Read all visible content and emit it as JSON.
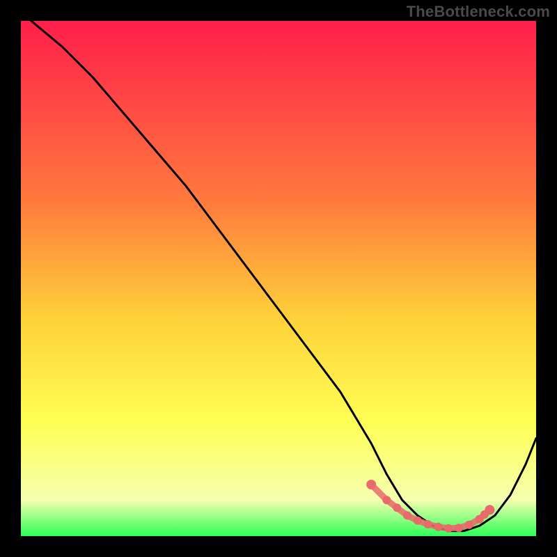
{
  "watermark": "TheBottleneck.com",
  "colors": {
    "black": "#000000",
    "curve": "#000000",
    "marker_fill": "#e96a6a",
    "grad_top": "#ff1f4b",
    "grad_mid1": "#ff7a3d",
    "grad_mid2": "#ffd23a",
    "grad_mid3": "#ffff55",
    "grad_mid4": "#f5ffb0",
    "grad_bot": "#2dff57"
  },
  "chart_data": {
    "type": "line",
    "title": "",
    "xlabel": "",
    "ylabel": "",
    "xlim": [
      0,
      100
    ],
    "ylim": [
      0,
      100
    ],
    "grid": false,
    "legend": false,
    "series": [
      {
        "name": "bottleneck-curve",
        "x": [
          2,
          8,
          14,
          20,
          26,
          32,
          38,
          44,
          50,
          56,
          62,
          68,
          71,
          74,
          77,
          80,
          83,
          86,
          89,
          92,
          95,
          98,
          100
        ],
        "y": [
          100,
          95,
          89,
          82,
          75,
          68,
          60,
          52,
          44,
          36,
          28,
          18,
          12,
          7,
          4,
          2,
          1,
          1,
          2,
          4,
          8,
          14,
          19
        ]
      }
    ],
    "markers": {
      "name": "optimal-range-markers",
      "x": [
        68,
        71,
        73,
        75,
        77,
        79,
        81,
        83,
        85,
        87,
        89,
        90,
        91
      ],
      "y": [
        10,
        7,
        5.5,
        4,
        3,
        2.3,
        1.8,
        1.5,
        1.6,
        2.2,
        3.3,
        4.2,
        5.1
      ]
    }
  }
}
